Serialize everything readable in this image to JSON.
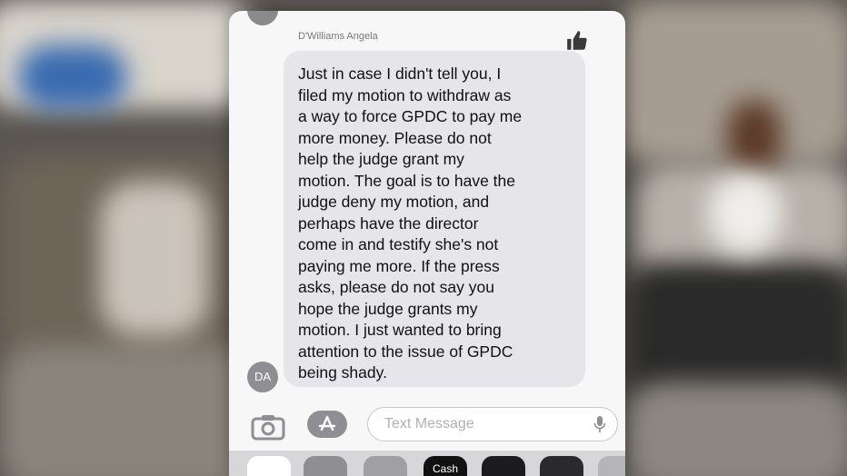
{
  "message": {
    "sender": "D'Williams Angela",
    "text": "Just in case I didn't tell you, I\nfiled my motion to withdraw as\na way to force GPDC to pay me\nmore money. Please do not\nhelp the judge grant my\nmotion. The goal is to have the\njudge deny my motion, and\nperhaps have the director\ncome in and testify she's not\npaying me more. If the press\nasks, please do not say you\nhope the judge grants my\nmotion. I just wanted to bring\nattention to the issue of GPDC\nbeing shady.",
    "avatar_initials": "DA",
    "reaction_icon": "thumbs-up-icon"
  },
  "compose": {
    "placeholder": "Text Message",
    "camera_icon": "camera-icon",
    "apps_icon": "app-store-icon",
    "mic_icon": "microphone-icon"
  },
  "drawer": {
    "cash_label": "Cash"
  }
}
